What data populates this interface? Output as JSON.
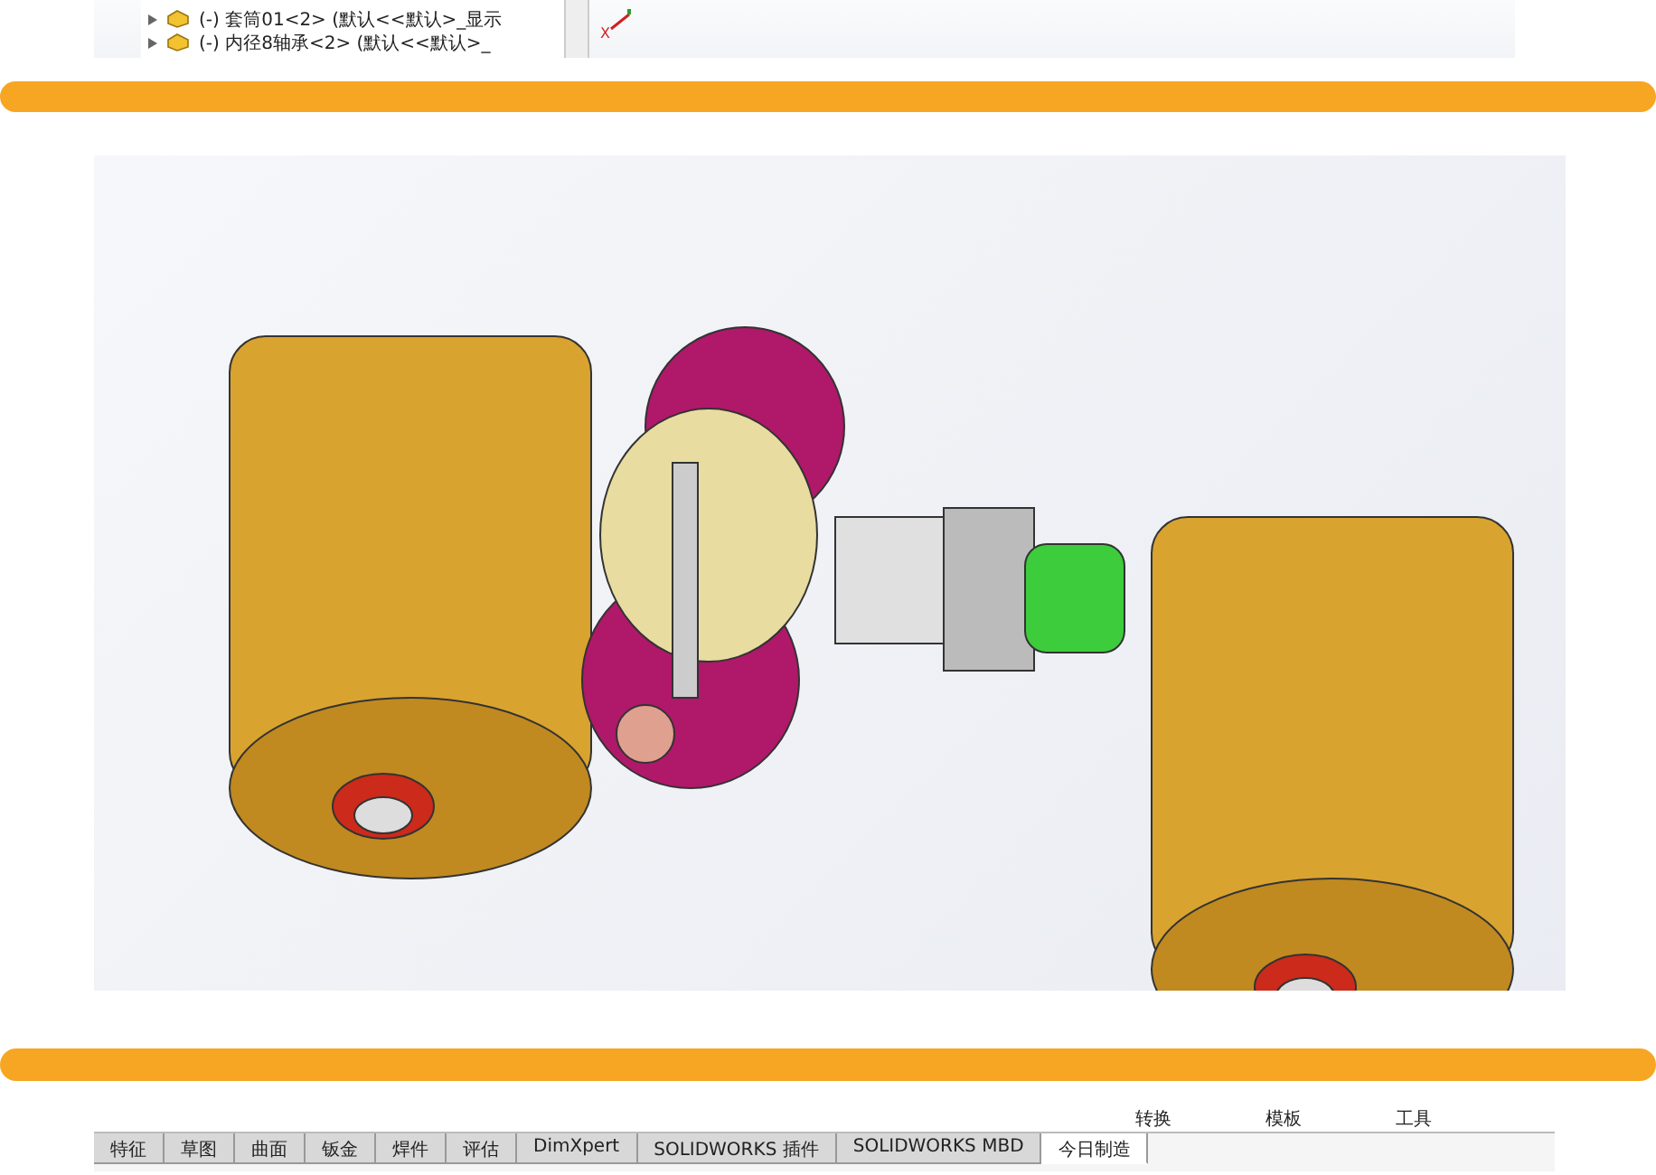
{
  "top_screenshot": {
    "tree_items": [
      {
        "label": "(-) 套筒01<2> (默认<<默认>_显示"
      },
      {
        "label": "(-) 内径8轴承<2> (默认<<默认>_"
      }
    ],
    "axis_label": "X"
  },
  "bottom_screenshot": {
    "ribbon_labels": [
      "转换",
      "模板",
      "工具"
    ],
    "tabs": [
      {
        "label": "特征",
        "selected": false
      },
      {
        "label": "草图",
        "selected": false
      },
      {
        "label": "曲面",
        "selected": false
      },
      {
        "label": "钣金",
        "selected": false
      },
      {
        "label": "焊件",
        "selected": false
      },
      {
        "label": "评估",
        "selected": false
      },
      {
        "label": "DimXpert",
        "selected": false
      },
      {
        "label": "SOLIDWORKS 插件",
        "selected": false
      },
      {
        "label": "SOLIDWORKS MBD",
        "selected": false
      },
      {
        "label": "今日制造",
        "selected": true
      }
    ]
  }
}
